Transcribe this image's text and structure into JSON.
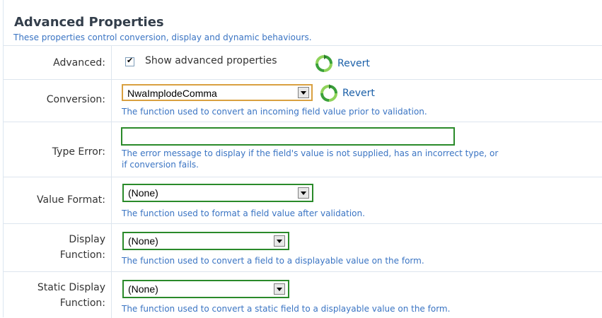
{
  "section": {
    "title": "Advanced Properties",
    "subtitle": "These properties control conversion, display and dynamic behaviours."
  },
  "rows": {
    "advanced": {
      "label": "Advanced:",
      "checkbox_label": "Show advanced properties",
      "checked": true,
      "revert_label": "Revert"
    },
    "conversion": {
      "label": "Conversion:",
      "selected": "NwaImplodeComma",
      "revert_label": "Revert",
      "help": "The function used to convert an incoming field value prior to validation."
    },
    "type_error": {
      "label": "Type Error:",
      "value": "",
      "help_line1": "The error message to display if the field's value is not supplied, has an incorrect type, or",
      "help_line2": "if conversion fails."
    },
    "value_format": {
      "label": "Value Format:",
      "selected": "(None)",
      "help": "The function used to format a field value after validation."
    },
    "display_function": {
      "label_line1": "Display",
      "label_line2": "Function:",
      "selected": "(None)",
      "help": "The function used to convert a field to a displayable value on the form."
    },
    "static_display_function": {
      "label_line1": "Static Display",
      "label_line2": "Function:",
      "selected": "(None)",
      "help": "The function used to convert a static field to a displayable value on the form."
    }
  },
  "icons": {
    "revert": "refresh-icon",
    "dropdown": "dropdown-arrow-icon",
    "check": "check-icon"
  },
  "colors": {
    "accent_text": "#3a74c3",
    "field_border_green": "#2a8a2a",
    "field_border_orange": "#d9a040",
    "revert_green": "#3aa03a"
  }
}
